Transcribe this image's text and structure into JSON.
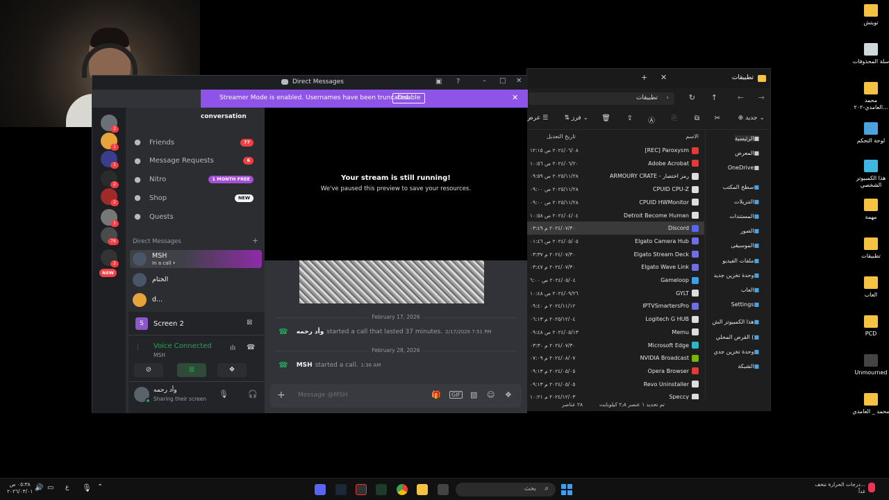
{
  "desktop": {
    "icons": [
      {
        "label": "تويتش",
        "color": "#f5c243"
      },
      {
        "label": "سلة المحذوفات",
        "color": "#cfd8dc"
      },
      {
        "label": "محمد العامدي-٢٠٢...",
        "color": "#f5c243"
      },
      {
        "label": "لوحة التحكم",
        "color": "#4aa3df"
      },
      {
        "label": "هذا الكمبيوتر الشخصي",
        "color": "#3fb6e0"
      },
      {
        "label": "مهمة",
        "color": "#f5c243"
      },
      {
        "label": "تطبيقات",
        "color": "#f5c243"
      },
      {
        "label": "العاب",
        "color": "#f5c243"
      },
      {
        "label": "PCD",
        "color": "#f5c243"
      },
      {
        "label": "Unmourned",
        "color": "#444"
      },
      {
        "label": "محمد _ العامدي",
        "color": "#f5c243"
      }
    ]
  },
  "explorer": {
    "tab_title": "تطبيقات",
    "address": "تطبيقات",
    "new_label": "جديد",
    "sort_label": "فرز",
    "view_label": "عرض",
    "col_name": "الاسم",
    "col_date": "تاريخ التعديل",
    "nav": [
      {
        "label": "الرئيسية",
        "icon": "home-icon"
      },
      {
        "label": "المعرض",
        "icon": "gallery-icon"
      },
      {
        "label": "OneDrive",
        "icon": "cloud-icon"
      },
      {
        "label": "سطح المكتب",
        "icon": "desktop-icon"
      },
      {
        "label": "التنزيلات",
        "icon": "download-icon"
      },
      {
        "label": "المستندات",
        "icon": "document-icon"
      },
      {
        "label": "الصور",
        "icon": "pictures-icon"
      },
      {
        "label": "الموسيقى",
        "icon": "music-icon"
      },
      {
        "label": "ملفات الفيديو",
        "icon": "video-icon"
      },
      {
        "label": "وحدة تخزين جديد",
        "icon": "drive-icon"
      },
      {
        "label": "العاب",
        "icon": "folder-icon"
      },
      {
        "label": "Settings",
        "icon": "folder-icon"
      },
      {
        "label": "هذا الكمبيوتر الش",
        "icon": "pc-icon"
      },
      {
        "label": "القرص المحلي (",
        "icon": "drive-icon"
      },
      {
        "label": "وحدة تخزين جدي",
        "icon": "drive-icon"
      },
      {
        "label": "الشبكة",
        "icon": "network-icon"
      }
    ],
    "files": [
      {
        "name": "[REC] Paroxysm",
        "date": "٢٠٢٤/٠٦/٠٨ ص ١٢:١٥",
        "color": "#e53935"
      },
      {
        "name": "Adobe Acrobat",
        "date": "٢٠٢٤/٠٦/٢٠ ص ١٠:٥٦",
        "color": "#e53935"
      },
      {
        "name": "ARMOURY CRATE - رمز اختصار",
        "date": "٢٠٢٥/١١/٢٨ ص ٠٩:٥٩",
        "color": "#ddd"
      },
      {
        "name": "CPUID CPU-Z",
        "date": "٢٠٢٥/١١/٢٨ ص ٠٩:٠٠",
        "color": "#ddd"
      },
      {
        "name": "CPUID HWMonitor",
        "date": "٢٠٢٥/١١/٢٨ ص ٠٩:٠٠",
        "color": "#ddd"
      },
      {
        "name": "Detroit Become Human",
        "date": "٢٠٢٤/٠٤/٠٤ ص ١٠:٥٨",
        "color": "#ddd"
      },
      {
        "name": "Discord",
        "date": "٢٠٢٤/٠٧/٣٠ م ٠٣:٤٩",
        "color": "#5865f2"
      },
      {
        "name": "Elgato Camera Hub",
        "date": "٢٠٢٤/٠٥/٠٥ ص ٠١:٤٦",
        "color": "#6e6ee6"
      },
      {
        "name": "Elgato Stream Deck",
        "date": "٢٠٢٤/٠٧/٣٠ م ٠٣:٣٧",
        "color": "#6e6ee6"
      },
      {
        "name": "Elgato Wave Link",
        "date": "٢٠٢٤/٠٧/٣٠ م ٠٣:٤٧",
        "color": "#6e6ee6"
      },
      {
        "name": "Gameloop",
        "date": "٢٠٢٤/٠٥/٠٤ ص ٦:٠٠",
        "color": "#3aa0e8"
      },
      {
        "name": "GYLT",
        "date": "٢٠٢٤/٠٩/٢٦ ص ١٠:٤٨",
        "color": "#ddd"
      },
      {
        "name": "IPTVSmartersPro",
        "date": "٢٠٢٤/١١/١٢ م ٠٩:٤٠",
        "color": "#6e6ee6"
      },
      {
        "name": "Logitech G HUB",
        "date": "٢٠٢٥/١٢/٠٤ م ٠٦:١٣",
        "color": "#ddd"
      },
      {
        "name": "Memu",
        "date": "٢٠٢٤/٠٥/١٣ ص ٠٩:٤٨",
        "color": "#ddd"
      },
      {
        "name": "Microsoft Edge",
        "date": "٢٠٢٤/٠٧/٣٠ م ٠٣:٣٠",
        "color": "#2bb6c9"
      },
      {
        "name": "NVIDIA Broadcast",
        "date": "٢٠٢٤/٠٨/٠٧ م ٠٧:٠٩",
        "color": "#76b900"
      },
      {
        "name": "Opera Browser",
        "date": "٢٠٢٤/٠٥/٠٥ م ٠٩:١٣",
        "color": "#e53935"
      },
      {
        "name": "Revo Uninstaller",
        "date": "٢٠٢٤/٠٥/٠٥ م ٠٩:١٣",
        "color": "#ddd"
      },
      {
        "name": "Speccy",
        "date": "٢٠٢٤/١٢/٠٣ م ١٠:٢١",
        "color": "#ddd"
      }
    ],
    "status_count": "٢٨ عناصر",
    "status_selected": "تم تحديد ١ عنصر  ٢٫٨ كيلوبايت"
  },
  "discord": {
    "window_title": "Direct Messages",
    "streamer_text": "Streamer Mode is enabled. Usernames have been truncated.",
    "disable_label": "Disable",
    "conversation_label": "conversation",
    "guild_badges": [
      "2",
      "1",
      "1",
      "2",
      "2",
      "1",
      "76",
      "2"
    ],
    "new_badge": "NEW",
    "menu": [
      {
        "label": "Friends",
        "icon": "friends-icon",
        "pill": "77",
        "pill_color": "#f23f43"
      },
      {
        "label": "Message Requests",
        "icon": "mail-icon",
        "pill": "6",
        "pill_color": "#f23f43"
      },
      {
        "label": "Nitro",
        "icon": "nitro-icon",
        "pill": "1 MONTH FREE",
        "pill_color": "#a44fd6"
      },
      {
        "label": "Shop",
        "icon": "shop-icon",
        "pill": "NEW",
        "pill_color": "#f2f3f5"
      },
      {
        "label": "Quests",
        "icon": "quests-icon",
        "pill": "",
        "pill_color": ""
      }
    ],
    "dm_header": "Direct Messages",
    "dms": [
      {
        "name": "MSH",
        "status": "In a call •"
      },
      {
        "name": "الختام",
        "status": ""
      },
      {
        "name": "d...",
        "status": ""
      }
    ],
    "screen_share_title": "Screen 2",
    "voice_connected": "Voice Connected",
    "voice_channel": "MSH",
    "user_name": "وأد رحمه",
    "user_status": "Sharing their screen",
    "stream_title": "Your stream is still running!",
    "stream_sub": "We've paused this preview to save your resources.",
    "date1": "February 17, 2026",
    "msg1_user": "وأد رحمه",
    "msg1_text": "started a call that lasted 37 minutes.",
    "msg1_time": "2/17/2026 7:51 PM",
    "date2": "February 28, 2026",
    "msg2_user": "MSH",
    "msg2_text": "started a call.",
    "msg2_time": "1:36 AM",
    "input_placeholder": "Message @MSH"
  },
  "taskbar": {
    "search_placeholder": "بحث",
    "clock_time": "٠٥:٣٨ ص",
    "clock_date": "٢٠٢٦/٠٣/٠١",
    "lang": "ع",
    "weather": "درجات الحرارة تنخف...",
    "weather_sub": "غداً"
  }
}
